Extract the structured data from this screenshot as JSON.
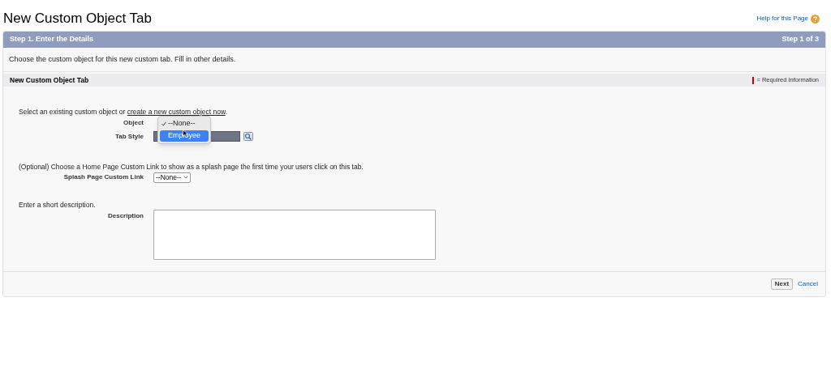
{
  "page_title": "New Custom Object Tab",
  "help_link": "Help for this Page",
  "step": {
    "title": "Step 1. Enter the Details",
    "counter": "Step 1 of 3"
  },
  "intro": "Choose the custom object for this new custom tab. Fill in other details.",
  "section": {
    "title": "New Custom Object Tab",
    "required_legend": "= Required Information"
  },
  "object_prompt": {
    "text": "Select an existing custom object or",
    "link": "create a new custom object now",
    "end": "."
  },
  "object_field": {
    "label": "Object",
    "options": [
      {
        "label": "--None--",
        "checked": true,
        "selected": false
      },
      {
        "label": "Employee",
        "checked": false,
        "selected": true
      }
    ]
  },
  "tab_style_field": {
    "label": "Tab Style"
  },
  "splash_prompt": "(Optional) Choose a Home Page Custom Link to show as a splash page the first time your users click on this tab.",
  "splash_field": {
    "label": "Splash Page Custom Link",
    "value": "--None--"
  },
  "description_prompt": "Enter a short description.",
  "description_field": {
    "label": "Description"
  },
  "buttons": [
    {
      "label": "Next",
      "kind": "button"
    },
    {
      "label": "Cancel",
      "kind": "link"
    }
  ]
}
